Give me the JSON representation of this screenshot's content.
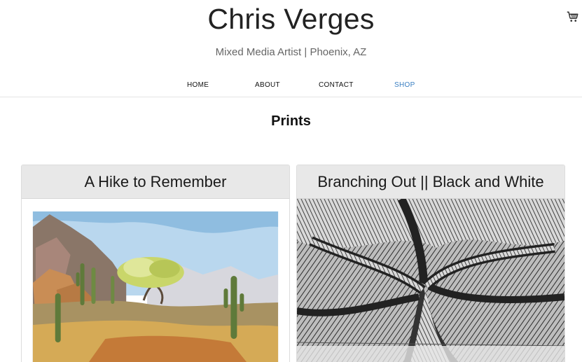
{
  "header": {
    "site_title": "Chris Verges",
    "tagline": "Mixed Media Artist | Phoenix, AZ",
    "cart_icon": "cart-icon"
  },
  "nav": {
    "items": [
      {
        "label": "HOME",
        "active": false
      },
      {
        "label": "ABOUT",
        "active": false
      },
      {
        "label": "CONTACT",
        "active": false
      },
      {
        "label": "SHOP",
        "active": true
      }
    ],
    "active_color": "#3a7fc2"
  },
  "main": {
    "section_title": "Prints",
    "products": [
      {
        "title": "A Hike to Remember",
        "image": "desert-landscape-watercolor"
      },
      {
        "title": "Branching Out || Black and White",
        "image": "tree-ink-drawing"
      }
    ]
  }
}
